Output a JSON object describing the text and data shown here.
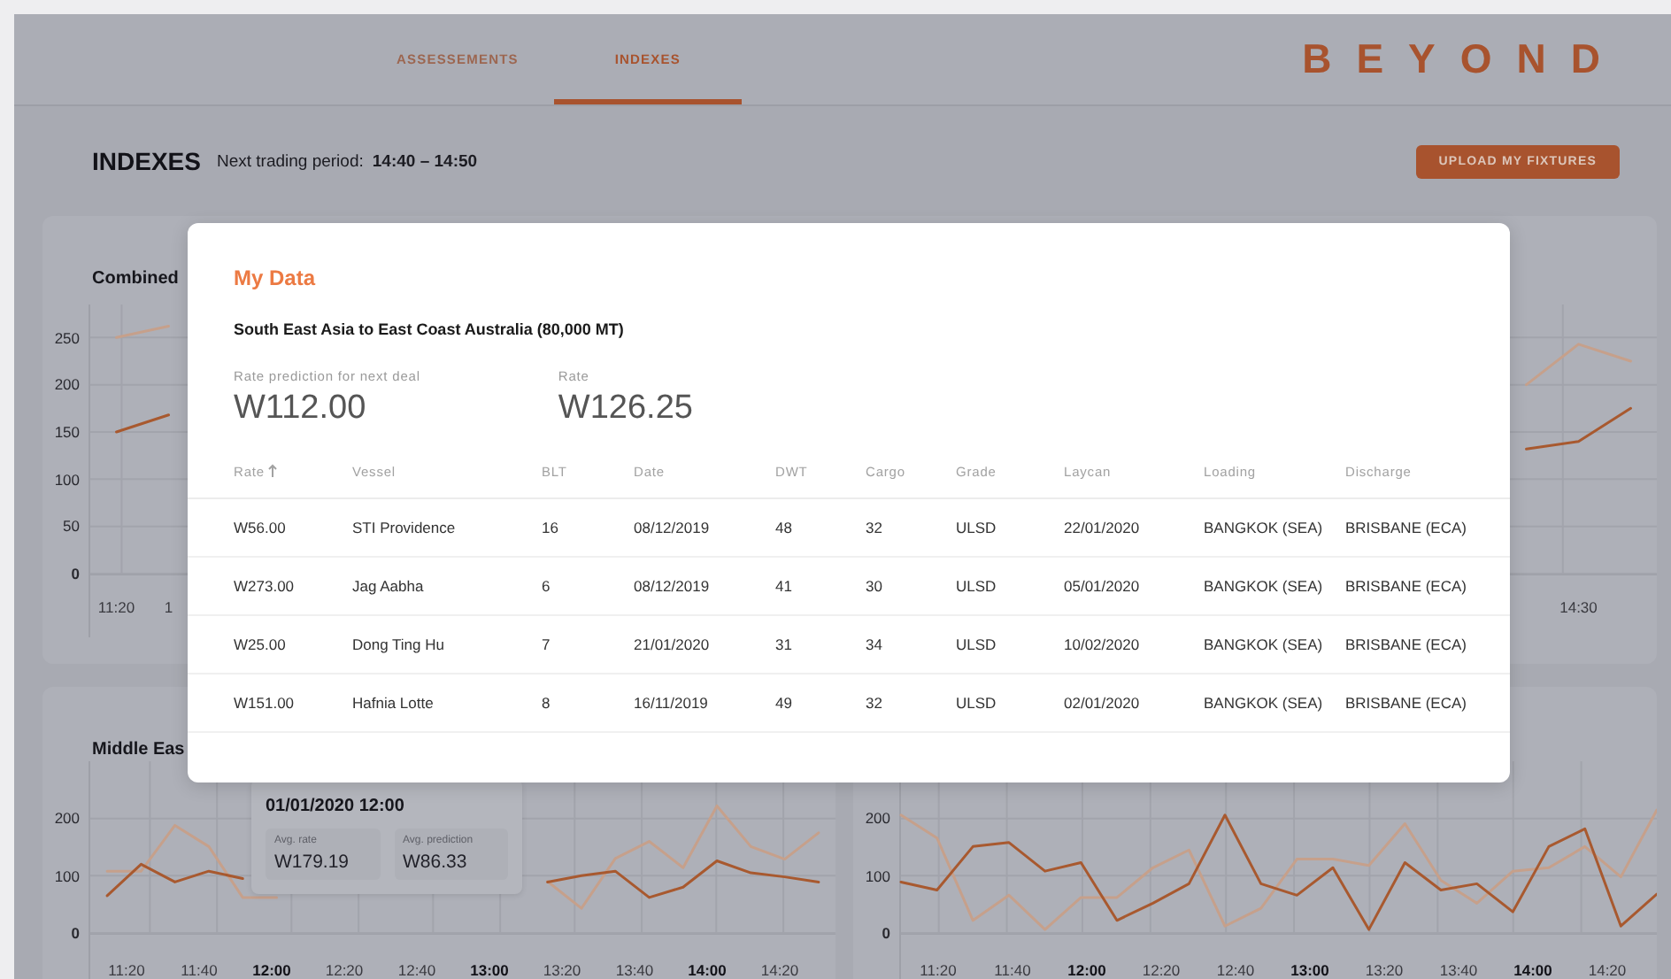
{
  "header": {
    "tabs": [
      {
        "label": "ASSESSEMENTS",
        "selected": false
      },
      {
        "label": "INDEXES",
        "selected": true
      }
    ],
    "logo": "BEYOND"
  },
  "page": {
    "title": "INDEXES",
    "period_label": "Next trading period:",
    "period": "14:40 – 14:50",
    "upload_button": "UPLOAD MY FIXTURES"
  },
  "charts": [
    {
      "title": "Combined",
      "xticks": [
        {
          "label": "11:20",
          "bold": false
        },
        {
          "label": "1",
          "bold": false
        },
        {
          "label": "14:30",
          "bold": false
        }
      ],
      "chart_data": {
        "type": "line",
        "grid": true,
        "ylim": [
          0,
          285
        ],
        "yticks": [
          {
            "value": 0,
            "label": "0"
          },
          {
            "value": 50,
            "label": "50"
          },
          {
            "value": 100,
            "label": "100"
          },
          {
            "value": 150,
            "label": "150"
          },
          {
            "value": 200,
            "label": "200"
          },
          {
            "value": 250,
            "label": "250"
          }
        ],
        "series": [
          {
            "color": "#c6a08b",
            "values": [
              250,
              262,
              null,
              null,
              null,
              null,
              null,
              null,
              null,
              null,
              null,
              null,
              null,
              null,
              null,
              null,
              null,
              null,
              null,
              null,
              null,
              null,
              null,
              null,
              null,
              null,
              null,
              200,
              243,
              225
            ]
          },
          {
            "color": "#a8592f",
            "values": [
              150,
              168,
              null,
              null,
              null,
              null,
              null,
              null,
              null,
              null,
              null,
              null,
              null,
              null,
              null,
              null,
              null,
              null,
              null,
              null,
              null,
              null,
              null,
              null,
              null,
              null,
              null,
              132,
              140,
              175
            ]
          }
        ]
      }
    },
    {
      "title": "Middle Eas",
      "xticks": [
        {
          "label": "11:20",
          "bold": false
        },
        {
          "label": "11:40",
          "bold": false
        },
        {
          "label": "12:00",
          "bold": true
        },
        {
          "label": "12:20",
          "bold": false
        },
        {
          "label": "12:40",
          "bold": false
        },
        {
          "label": "13:00",
          "bold": true
        },
        {
          "label": "13:20",
          "bold": false
        },
        {
          "label": "13:40",
          "bold": false
        },
        {
          "label": "14:00",
          "bold": true
        },
        {
          "label": "14:20",
          "bold": false
        }
      ],
      "chart_data": {
        "type": "line",
        "grid": true,
        "ylim": [
          0,
          300
        ],
        "yticks": [
          {
            "value": 0,
            "label": "0"
          },
          {
            "value": 100,
            "label": "100"
          },
          {
            "value": 200,
            "label": "200"
          }
        ],
        "series": [
          {
            "color": "#c6a08b",
            "values": [
              108,
              108,
              188,
              151,
              62,
              62,
              null,
              null,
              null,
              null,
              null,
              null,
              null,
              90,
              43,
              130,
              160,
              114,
              222,
              151,
              129,
              175
            ]
          },
          {
            "color": "#a8592f",
            "values": [
              65,
              120,
              89,
              108,
              95,
              null,
              null,
              null,
              null,
              null,
              null,
              null,
              null,
              89,
              100,
              108,
              62,
              80,
              126,
              105,
              98,
              89
            ]
          }
        ]
      },
      "tooltip": {
        "title": "01/01/2020 12:00",
        "items": [
          {
            "label": "Avg. rate",
            "value": "W179.19"
          },
          {
            "label": "Avg. prediction",
            "value": "W86.33"
          }
        ]
      }
    },
    {
      "xticks": [
        {
          "label": "11:20",
          "bold": false
        },
        {
          "label": "11:40",
          "bold": false
        },
        {
          "label": "12:00",
          "bold": true
        },
        {
          "label": "12:20",
          "bold": false
        },
        {
          "label": "12:40",
          "bold": false
        },
        {
          "label": "13:00",
          "bold": true
        },
        {
          "label": "13:20",
          "bold": false
        },
        {
          "label": "13:40",
          "bold": false
        },
        {
          "label": "14:00",
          "bold": true
        },
        {
          "label": "14:20",
          "bold": false
        }
      ],
      "chart_data": {
        "type": "line",
        "grid": true,
        "ylim": [
          0,
          300
        ],
        "yticks": [
          {
            "value": 0,
            "label": "0"
          },
          {
            "value": 100,
            "label": "100"
          },
          {
            "value": 200,
            "label": "200"
          }
        ],
        "series": [
          {
            "color": "#c6a08b",
            "values": [
              206,
              166,
              22,
              66,
              6,
              62,
              62,
              114,
              145,
              12,
              43,
              129,
              129,
              118,
              191,
              92,
              52,
              108,
              114,
              151,
              98,
              215
            ]
          },
          {
            "color": "#a8592f",
            "values": [
              89,
              75,
              151,
              158,
              108,
              123,
              22,
              52,
              86,
              206,
              86,
              66,
              114,
              6,
              123,
              75,
              86,
              37,
              151,
              182,
              12,
              68
            ]
          }
        ]
      }
    }
  ],
  "modal": {
    "title": "My Data",
    "route": "South East Asia to East Coast Australia (80,000 MT)",
    "stats": [
      {
        "label": "Rate prediction for next deal",
        "value": "W112.00"
      },
      {
        "label": "Rate",
        "value": "W126.25"
      }
    ],
    "columns": [
      {
        "label": "Rate",
        "sorted": true
      },
      {
        "label": "Vessel",
        "sorted": false
      },
      {
        "label": "BLT",
        "sorted": false
      },
      {
        "label": "Date",
        "sorted": false
      },
      {
        "label": "DWT",
        "sorted": false
      },
      {
        "label": "Cargo",
        "sorted": false
      },
      {
        "label": "Grade",
        "sorted": false
      },
      {
        "label": "Laycan",
        "sorted": false
      },
      {
        "label": "Loading",
        "sorted": false
      },
      {
        "label": "Discharge",
        "sorted": false
      }
    ],
    "rows": [
      [
        "W56.00",
        "STI Providence",
        "16",
        "08/12/2019",
        "48",
        "32",
        "ULSD",
        "22/01/2020",
        "BANGKOK (SEA)",
        "BRISBANE (ECA)"
      ],
      [
        "W273.00",
        "Jag Aabha",
        "6",
        "08/12/2019",
        "41",
        "30",
        "ULSD",
        "05/01/2020",
        "BANGKOK (SEA)",
        "BRISBANE (ECA)"
      ],
      [
        "W25.00",
        "Dong Ting Hu",
        "7",
        "21/01/2020",
        "31",
        "34",
        "ULSD",
        "10/02/2020",
        "BANGKOK (SEA)",
        "BRISBANE (ECA)"
      ],
      [
        "W151.00",
        "Hafnia Lotte",
        "8",
        "16/11/2019",
        "49",
        "32",
        "ULSD",
        "02/01/2020",
        "BANGKOK (SEA)",
        "BRISBANE (ECA)"
      ]
    ]
  }
}
